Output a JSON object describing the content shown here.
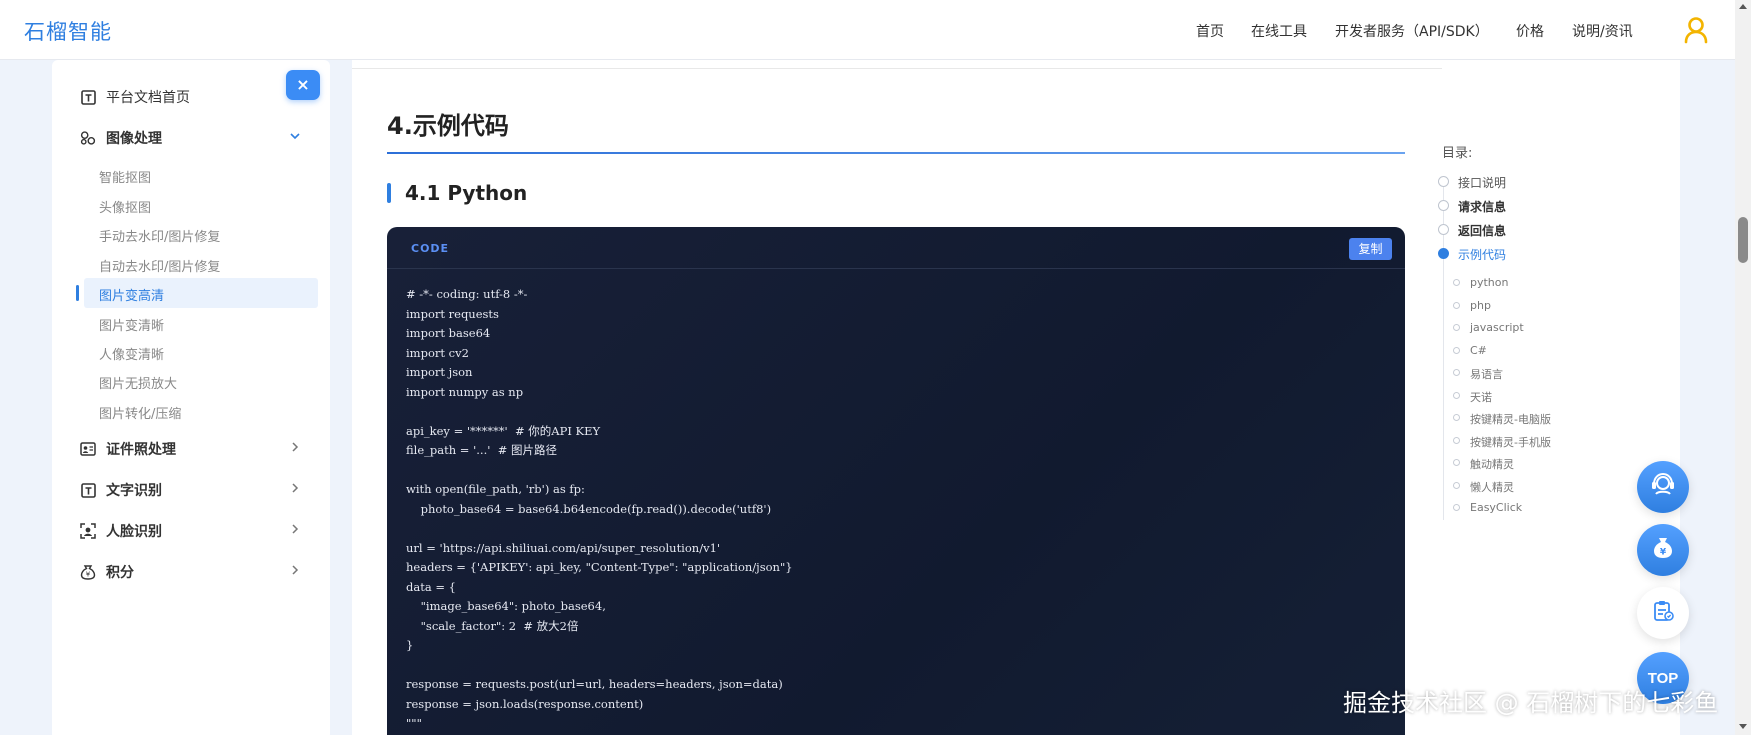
{
  "header": {
    "brand": "石榴智能",
    "nav": [
      "首页",
      "在线工具",
      "开发者服务（API/SDK）",
      "价格",
      "说明/资讯"
    ]
  },
  "sidebar": {
    "close_label": "×",
    "items": [
      {
        "label": "平台文档首页",
        "icon": "document-icon"
      },
      {
        "label": "图像处理",
        "icon": "image-process-icon"
      },
      {
        "label": "证件照处理",
        "icon": "id-photo-icon"
      },
      {
        "label": "文字识别",
        "icon": "text-recognition-icon"
      },
      {
        "label": "人脸识别",
        "icon": "face-recognition-icon"
      },
      {
        "label": "积分",
        "icon": "points-icon"
      }
    ],
    "sub_items": [
      "智能抠图",
      "头像抠图",
      "手动去水印/图片修复",
      "自动去水印/图片修复",
      "图片变高清",
      "图片变清晰",
      "人像变清晰",
      "图片无损放大",
      "图片转化/压缩"
    ],
    "active_sub": "图片变高清"
  },
  "main": {
    "section_title": "4.示例代码",
    "sub_title": "4.1 Python",
    "code_label": "CODE",
    "copy_label": "复制",
    "code_lines": [
      "# -*- coding: utf-8 -*-",
      "import requests",
      "import base64",
      "import cv2",
      "import json",
      "import numpy as np",
      "",
      "api_key = '******'  # 你的API KEY",
      "file_path = '...'  # 图片路径",
      "",
      "with open(file_path, 'rb') as fp:",
      "    photo_base64 = base64.b64encode(fp.read()).decode('utf8')",
      "",
      "url = 'https://api.shiliuai.com/api/super_resolution/v1'",
      "headers = {'APIKEY': api_key, \"Content-Type\": \"application/json\"}",
      "data = {",
      "    \"image_base64\": photo_base64,",
      "    \"scale_factor\": 2  # 放大2倍",
      "}",
      "",
      "response = requests.post(url=url, headers=headers, json=data)",
      "response = json.loads(response.content)",
      "\"\"\""
    ]
  },
  "toc": {
    "title": "目录:",
    "items": [
      "接口说明",
      "请求信息",
      "返回信息",
      "示例代码"
    ],
    "active": "示例代码",
    "sub_items": [
      "python",
      "php",
      "javascript",
      "C#",
      "易语言",
      "天诺",
      "按键精灵-电脑版",
      "按键精灵-手机版",
      "触动精灵",
      "懒人精灵",
      "EasyClick"
    ]
  },
  "floating": {
    "top_label": "TOP"
  },
  "watermark": "掘金技术社区 @ 石榴树下的七彩鱼",
  "colors": {
    "accent": "#2f7fe0",
    "code_bg": "#151d33"
  }
}
